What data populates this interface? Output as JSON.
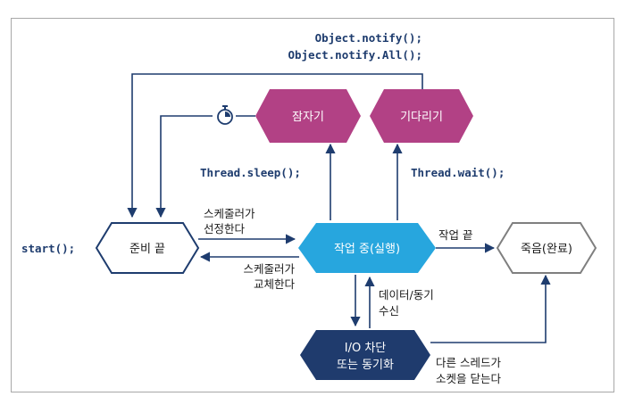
{
  "code": {
    "notify": "Object.notify();",
    "notify_all": "Object.notify.All();",
    "sleep": "Thread.sleep();",
    "wait": "Thread.wait();",
    "start": "start();"
  },
  "nodes": {
    "ready": "준비 끝",
    "running": "작업 중(실행)",
    "dead": "죽음(완료)",
    "sleeping": "잠자기",
    "waiting": "기다리기",
    "blocked_line1": "I/O 차단",
    "blocked_line2": "또는 동기화"
  },
  "labels": {
    "scheduler_select_line1": "스케줄러가",
    "scheduler_select_line2": "선정한다",
    "scheduler_swap_line1": "스케줄러가",
    "scheduler_swap_line2": "교체한다",
    "work_done": "작업 끝",
    "data_sync_line1": "데이터/동기",
    "data_sync_line2": "수신",
    "socket_close_line1": "다른 스레드가",
    "socket_close_line2": "소켓을 닫는다"
  },
  "colors": {
    "sleeping": "#b24185",
    "waiting": "#b24185",
    "running": "#27a6de",
    "blocked": "#1f3b6d",
    "arrows": "#1e3c6e",
    "dead_border": "#7f7f7f"
  }
}
